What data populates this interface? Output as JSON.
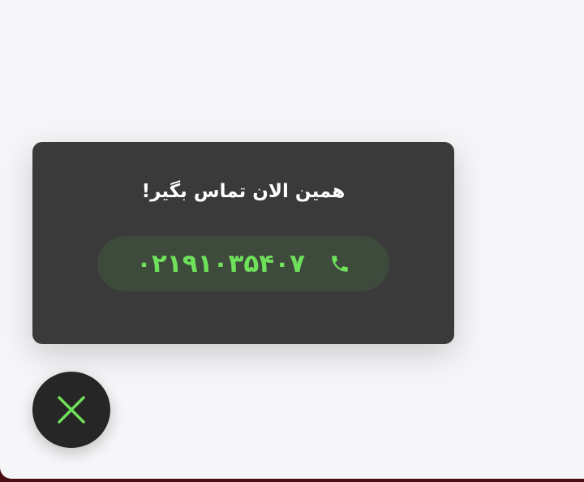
{
  "popup": {
    "title": "همین الان تماس بگیر!",
    "phone_number": "۰۲۱۹۱۰۳۵۴۰۷"
  },
  "icons": {
    "phone": "phone-icon",
    "close": "close-icon"
  },
  "colors": {
    "popup_background": "#3a3a3a",
    "accent_green": "#6fe05a",
    "pill_background": "#3d4a3c",
    "fab_background": "#262626",
    "page_background": "#f6f6f8"
  }
}
